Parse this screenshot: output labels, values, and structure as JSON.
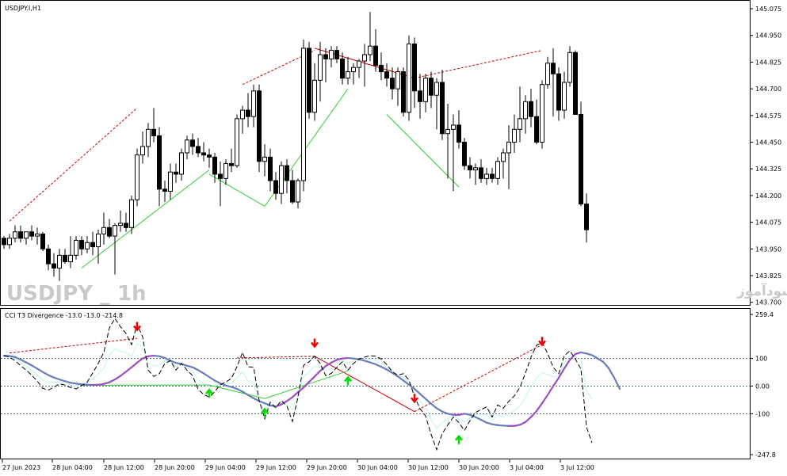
{
  "symbol_title": "USDJPY.I,H1",
  "indicator_title": "CCI T3 Divergence -13.0 -13.0 -214.8",
  "watermark_left": "USDJPY _ 1h",
  "watermark_right": "انتشار در سایت سودآموز",
  "colors": {
    "bull_body": "#ffffff",
    "bear_body": "#000000",
    "bear_div": "#cc0000",
    "bull_div": "#33cc33",
    "t3_line": "#9c4fc4",
    "t3_down": "#6b7db8",
    "cci_line": "#000000",
    "cyan_line": "#bff3f3",
    "arrow_down": "#ee0000",
    "arrow_up": "#00dd00"
  },
  "chart_data": [
    {
      "type": "candlestick",
      "name": "USDJPY.I,H1",
      "y_ticks": [
        "145.075",
        "144.950",
        "144.825",
        "144.700",
        "144.575",
        "144.450",
        "144.325",
        "144.200",
        "144.075",
        "143.950",
        "143.825",
        "143.700"
      ],
      "ylim": [
        143.695,
        145.09
      ],
      "x_ticks": [
        "27 Jun 2023",
        "28 Jun 04:00",
        "28 Jun 12:00",
        "28 Jun 20:00",
        "29 Jun 04:00",
        "29 Jun 12:00",
        "29 Jun 20:00",
        "30 Jun 04:00",
        "30 Jun 12:00",
        "30 Jun 20:00",
        "3 Jul 04:00",
        "3 Jul 12:00"
      ],
      "candles": [
        [
          144.0,
          144.01,
          143.95,
          143.97
        ],
        [
          143.97,
          144.02,
          143.95,
          144.0
        ],
        [
          144.0,
          144.06,
          143.98,
          144.03
        ],
        [
          144.03,
          144.06,
          143.98,
          144.0
        ],
        [
          144.0,
          144.03,
          143.97,
          144.03
        ],
        [
          144.03,
          144.06,
          143.99,
          144.01
        ],
        [
          144.01,
          144.05,
          143.97,
          144.02
        ],
        [
          144.02,
          144.03,
          143.94,
          143.95
        ],
        [
          143.95,
          143.97,
          143.85,
          143.88
        ],
        [
          143.88,
          143.93,
          143.82,
          143.86
        ],
        [
          143.86,
          143.95,
          143.8,
          143.92
        ],
        [
          143.92,
          143.95,
          143.88,
          143.89
        ],
        [
          143.89,
          144.01,
          143.86,
          143.92
        ],
        [
          143.92,
          144.01,
          143.9,
          143.99
        ],
        [
          143.99,
          144.01,
          143.92,
          143.95
        ],
        [
          143.95,
          144.01,
          143.93,
          143.98
        ],
        [
          143.98,
          144.03,
          143.92,
          143.96
        ],
        [
          143.96,
          144.04,
          143.88,
          144.02
        ],
        [
          144.02,
          144.12,
          143.97,
          144.05
        ],
        [
          144.05,
          144.09,
          144.0,
          144.01
        ],
        [
          144.01,
          144.07,
          143.83,
          144.06
        ],
        [
          144.06,
          144.13,
          144.03,
          144.07
        ],
        [
          144.07,
          144.12,
          144.03,
          144.05
        ],
        [
          144.05,
          144.2,
          144.02,
          144.18
        ],
        [
          144.18,
          144.42,
          144.15,
          144.39
        ],
        [
          144.39,
          144.5,
          144.35,
          144.43
        ],
        [
          144.43,
          144.54,
          144.38,
          144.51
        ],
        [
          144.51,
          144.61,
          144.45,
          144.48
        ],
        [
          144.48,
          144.52,
          144.15,
          144.23
        ],
        [
          144.23,
          144.27,
          144.17,
          144.22
        ],
        [
          144.22,
          144.35,
          144.18,
          144.31
        ],
        [
          144.31,
          144.35,
          144.26,
          144.3
        ],
        [
          144.3,
          144.42,
          144.27,
          144.4
        ],
        [
          144.4,
          144.48,
          144.37,
          144.46
        ],
        [
          144.46,
          144.49,
          144.39,
          144.43
        ],
        [
          144.43,
          144.47,
          144.38,
          144.4
        ],
        [
          144.4,
          144.45,
          144.36,
          144.39
        ],
        [
          144.39,
          144.42,
          144.33,
          144.38
        ],
        [
          144.38,
          144.4,
          144.26,
          144.3
        ],
        [
          144.3,
          144.36,
          144.15,
          144.28
        ],
        [
          144.28,
          144.37,
          144.25,
          144.35
        ],
        [
          144.35,
          144.42,
          144.31,
          144.34
        ],
        [
          144.34,
          144.58,
          144.33,
          144.56
        ],
        [
          144.56,
          144.62,
          144.49,
          144.6
        ],
        [
          144.6,
          144.68,
          144.52,
          144.57
        ],
        [
          144.57,
          144.72,
          144.52,
          144.69
        ],
        [
          144.69,
          144.72,
          144.31,
          144.36
        ],
        [
          144.36,
          144.44,
          144.29,
          144.38
        ],
        [
          144.38,
          144.42,
          144.22,
          144.27
        ],
        [
          144.27,
          144.31,
          144.18,
          144.21
        ],
        [
          144.21,
          144.36,
          144.16,
          144.34
        ],
        [
          144.34,
          144.37,
          144.21,
          144.27
        ],
        [
          144.27,
          144.32,
          144.16,
          144.17
        ],
        [
          144.17,
          144.28,
          144.14,
          144.27
        ],
        [
          144.27,
          144.93,
          144.22,
          144.89
        ],
        [
          144.89,
          144.92,
          144.56,
          144.59
        ],
        [
          144.59,
          144.82,
          144.55,
          144.74
        ],
        [
          144.74,
          144.92,
          144.64,
          144.86
        ],
        [
          144.86,
          144.89,
          144.73,
          144.84
        ],
        [
          144.84,
          144.9,
          144.8,
          144.88
        ],
        [
          144.88,
          144.9,
          144.82,
          144.84
        ],
        [
          144.84,
          144.87,
          144.72,
          144.75
        ],
        [
          144.75,
          144.85,
          144.72,
          144.78
        ],
        [
          144.78,
          144.82,
          144.72,
          144.8
        ],
        [
          144.8,
          144.84,
          144.75,
          144.83
        ],
        [
          144.83,
          144.91,
          144.71,
          144.86
        ],
        [
          144.86,
          145.06,
          144.83,
          144.9
        ],
        [
          144.9,
          144.98,
          144.78,
          144.81
        ],
        [
          144.81,
          144.87,
          144.74,
          144.78
        ],
        [
          144.78,
          144.82,
          144.71,
          144.75
        ],
        [
          144.75,
          144.8,
          144.65,
          144.7
        ],
        [
          144.7,
          144.8,
          144.62,
          144.78
        ],
        [
          144.78,
          144.8,
          144.57,
          144.59
        ],
        [
          144.59,
          144.95,
          144.55,
          144.91
        ],
        [
          144.91,
          144.94,
          144.61,
          144.69
        ],
        [
          144.69,
          144.77,
          144.56,
          144.64
        ],
        [
          144.64,
          144.77,
          144.59,
          144.75
        ],
        [
          144.75,
          144.78,
          144.61,
          144.67
        ],
        [
          144.67,
          144.75,
          144.51,
          144.73
        ],
        [
          144.73,
          144.79,
          144.46,
          144.49
        ],
        [
          144.49,
          144.63,
          144.28,
          144.51
        ],
        [
          144.51,
          144.58,
          144.22,
          144.53
        ],
        [
          144.53,
          144.6,
          144.42,
          144.45
        ],
        [
          144.45,
          144.47,
          144.32,
          144.34
        ],
        [
          144.34,
          144.38,
          144.28,
          144.32
        ],
        [
          144.32,
          144.35,
          144.25,
          144.33
        ],
        [
          144.33,
          144.37,
          144.26,
          144.28
        ],
        [
          144.28,
          144.33,
          144.25,
          144.3
        ],
        [
          144.3,
          144.33,
          144.26,
          144.28
        ],
        [
          144.28,
          144.38,
          144.25,
          144.36
        ],
        [
          144.36,
          144.42,
          144.28,
          144.4
        ],
        [
          144.4,
          144.53,
          144.23,
          144.45
        ],
        [
          144.45,
          144.58,
          144.4,
          144.51
        ],
        [
          144.51,
          144.71,
          144.45,
          144.56
        ],
        [
          144.56,
          144.67,
          144.49,
          144.64
        ],
        [
          144.64,
          144.7,
          144.52,
          144.57
        ],
        [
          144.57,
          144.65,
          144.44,
          144.45
        ],
        [
          144.45,
          144.74,
          144.42,
          144.72
        ],
        [
          144.72,
          144.85,
          144.7,
          144.82
        ],
        [
          144.82,
          144.89,
          144.57,
          144.77
        ],
        [
          144.77,
          144.8,
          144.55,
          144.6
        ],
        [
          144.6,
          144.78,
          144.56,
          144.73
        ],
        [
          144.73,
          144.9,
          144.71,
          144.87
        ],
        [
          144.87,
          144.88,
          144.58,
          144.58
        ],
        [
          144.58,
          144.64,
          144.15,
          144.16
        ],
        [
          144.16,
          144.21,
          143.98,
          144.04
        ]
      ],
      "trendlines": [
        {
          "kind": "bearish-divergence",
          "from": {
            "bar": 1,
            "price": 144.08
          },
          "to": {
            "bar": 24,
            "price": 144.61
          }
        },
        {
          "kind": "bearish-divergence",
          "from": {
            "bar": 43,
            "price": 144.72
          },
          "to": {
            "bar": 56,
            "price": 144.88
          }
        },
        {
          "kind": "bearish-divergence",
          "from": {
            "bar": 56,
            "price": 144.89
          },
          "to": {
            "bar": 74,
            "price": 144.75
          }
        },
        {
          "kind": "bearish-divergence",
          "from": {
            "bar": 74,
            "price": 144.75
          },
          "to": {
            "bar": 97,
            "price": 144.88
          }
        },
        {
          "kind": "bullish-divergence",
          "from": {
            "bar": 14,
            "price": 143.86
          },
          "to": {
            "bar": 37,
            "price": 144.32
          }
        },
        {
          "kind": "bullish-divergence",
          "from": {
            "bar": 37,
            "price": 144.3
          },
          "to": {
            "bar": 47,
            "price": 144.15
          }
        },
        {
          "kind": "bullish-divergence",
          "from": {
            "bar": 47,
            "price": 144.15
          },
          "to": {
            "bar": 62,
            "price": 144.7
          }
        },
        {
          "kind": "bullish-divergence",
          "from": {
            "bar": 69,
            "price": 144.58
          },
          "to": {
            "bar": 82,
            "price": 144.24
          }
        }
      ]
    },
    {
      "type": "line",
      "name": "CCI T3 Divergence",
      "y_ticks": [
        "259.4",
        "100",
        "0.00",
        "-100",
        "-247.8"
      ],
      "ylim": [
        -247.8,
        259.4
      ],
      "levels": [
        100,
        0,
        -100
      ],
      "series": [
        {
          "values": [
            110,
            105,
            92,
            74,
            58,
            40,
            18,
            -8,
            -14,
            -4,
            8,
            4,
            -5,
            -10,
            2,
            14,
            48,
            82,
            122,
            210,
            245,
            215,
            190,
            150,
            225,
            178,
            58,
            35,
            45,
            82,
            92,
            58,
            82,
            58,
            38,
            -12,
            -30,
            -40,
            -20,
            5,
            15,
            28,
            70,
            122,
            70,
            68,
            -52,
            -118,
            -58,
            -78,
            -52,
            -72,
            -128,
            -40,
            75,
            88,
            108,
            82,
            38,
            46,
            68,
            88,
            58,
            82,
            98,
            105,
            110,
            108,
            98,
            78,
            52,
            40,
            45,
            22,
            -38,
            -82,
            -108,
            -175,
            -230,
            -172,
            -140,
            -112,
            -132,
            -160,
            -125,
            -95,
            -85,
            -75,
            -112,
            -68,
            -80,
            -55,
            -35,
            -5,
            48,
            105,
            148,
            158,
            118,
            68,
            45,
            110,
            128,
            98,
            62,
            -148,
            -205
          ]
        },
        {
          "name": "T3",
          "values": [
            110,
            109,
            105,
            96,
            86,
            75,
            63,
            51,
            40,
            31,
            24,
            18,
            12,
            9,
            6,
            5,
            4,
            5,
            8,
            14,
            24,
            37,
            52,
            68,
            85,
            100,
            108,
            110,
            108,
            102,
            92,
            84,
            80,
            74,
            68,
            58,
            46,
            33,
            20,
            10,
            2,
            -3,
            -10,
            -20,
            -32,
            -44,
            -54,
            -62,
            -70,
            -74,
            -66,
            -54,
            -40,
            -22,
            -5,
            15,
            35,
            55,
            73,
            85,
            95,
            100,
            102,
            100,
            97,
            92,
            86,
            79,
            70,
            60,
            48,
            35,
            20,
            5,
            -10,
            -28,
            -46,
            -64,
            -80,
            -92,
            -100,
            -104,
            -104,
            -100,
            -104,
            -112,
            -122,
            -132,
            -138,
            -141,
            -143,
            -144,
            -144,
            -140,
            -130,
            -112,
            -90,
            -62,
            -32,
            0,
            30,
            64,
            95,
            116,
            122,
            118,
            112,
            100,
            88,
            65,
            30,
            -10
          ]
        }
      ],
      "divergence_lines": [
        {
          "kind": "bearish",
          "from": {
            "bar": 1,
            "value": 120
          },
          "to": {
            "bar": 24,
            "value": 173
          }
        },
        {
          "kind": "bearish",
          "from": {
            "bar": 42,
            "value": 102
          },
          "to": {
            "bar": 56,
            "value": 108
          }
        },
        {
          "kind": "bearish",
          "from": {
            "bar": 56,
            "value": 108
          },
          "to": {
            "bar": 74,
            "value": -92
          }
        },
        {
          "kind": "bearish",
          "from": {
            "bar": 74,
            "value": -92
          },
          "to": {
            "bar": 97,
            "value": 150
          }
        },
        {
          "kind": "bullish",
          "from": {
            "bar": 14,
            "value": 3
          },
          "to": {
            "bar": 37,
            "value": 4
          }
        },
        {
          "kind": "bullish",
          "from": {
            "bar": 37,
            "value": 4
          },
          "to": {
            "bar": 47,
            "value": -45
          }
        },
        {
          "kind": "bullish",
          "from": {
            "bar": 47,
            "value": -45
          },
          "to": {
            "bar": 62,
            "value": 55
          }
        }
      ],
      "arrows": [
        {
          "dir": "down",
          "bar": 24,
          "value": 212
        },
        {
          "dir": "down",
          "bar": 56,
          "value": 152
        },
        {
          "dir": "down",
          "bar": 74,
          "value": -48
        },
        {
          "dir": "down",
          "bar": 97,
          "value": 158
        },
        {
          "dir": "up",
          "bar": 37,
          "value": -22
        },
        {
          "dir": "up",
          "bar": 47,
          "value": -92
        },
        {
          "dir": "up",
          "bar": 62,
          "value": 23
        },
        {
          "dir": "up",
          "bar": 82,
          "value": -190
        }
      ]
    }
  ]
}
